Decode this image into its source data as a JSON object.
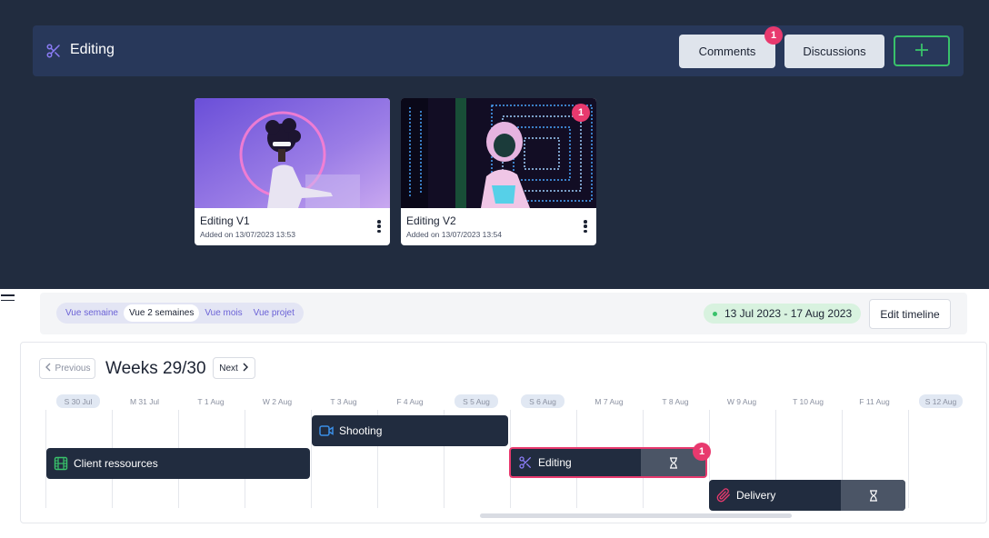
{
  "header": {
    "title": "Editing",
    "icon": "scissors-icon",
    "comments_label": "Comments",
    "comments_badge": "1",
    "discussions_label": "Discussions",
    "add_icon": "plus-icon",
    "accent_color": "#39c26b"
  },
  "files": [
    {
      "title": "Editing V1",
      "date": "Added on 13/07/2023 13:53",
      "badge": ""
    },
    {
      "title": "Editing V2",
      "date": "Added on 13/07/2023 13:54",
      "badge": "1"
    }
  ],
  "toolbar": {
    "views": [
      "Vue semaine",
      "Vue 2 semaines",
      "Vue mois",
      "Vue projet"
    ],
    "active_view": "Vue 2 semaines",
    "date_range": "13 Jul 2023 - 17 Aug 2023",
    "edit_timeline_label": "Edit timeline"
  },
  "timeline": {
    "previous_label": "Previous",
    "title": "Weeks 29/30",
    "next_label": "Next",
    "days": [
      {
        "label": "S 30 Jul",
        "weekend": true
      },
      {
        "label": "M 31 Jul",
        "weekend": false
      },
      {
        "label": "T 1 Aug",
        "weekend": false
      },
      {
        "label": "W 2 Aug",
        "weekend": false
      },
      {
        "label": "T 3 Aug",
        "weekend": false
      },
      {
        "label": "F 4 Aug",
        "weekend": false
      },
      {
        "label": "S 5 Aug",
        "weekend": true
      },
      {
        "label": "S 6 Aug",
        "weekend": true
      },
      {
        "label": "M 7 Aug",
        "weekend": false
      },
      {
        "label": "T 8 Aug",
        "weekend": false
      },
      {
        "label": "W 9 Aug",
        "weekend": false
      },
      {
        "label": "T 10 Aug",
        "weekend": false
      },
      {
        "label": "F 11 Aug",
        "weekend": false
      },
      {
        "label": "S 12 Aug",
        "weekend": true
      }
    ],
    "tasks": {
      "shooting": {
        "label": "Shooting",
        "icon": "video-camera-icon",
        "icon_color": "#3a8ee6"
      },
      "client": {
        "label": "Client ressources",
        "icon": "film-icon",
        "icon_color": "#39c26b"
      },
      "editing": {
        "label": "Editing",
        "icon": "scissors-icon",
        "icon_color": "#8b7cf6",
        "badge": "1",
        "status_icon": "hourglass-icon"
      },
      "delivery": {
        "label": "Delivery",
        "icon": "paperclip-icon",
        "icon_color": "#e8396e",
        "status_icon": "hourglass-icon"
      }
    }
  }
}
